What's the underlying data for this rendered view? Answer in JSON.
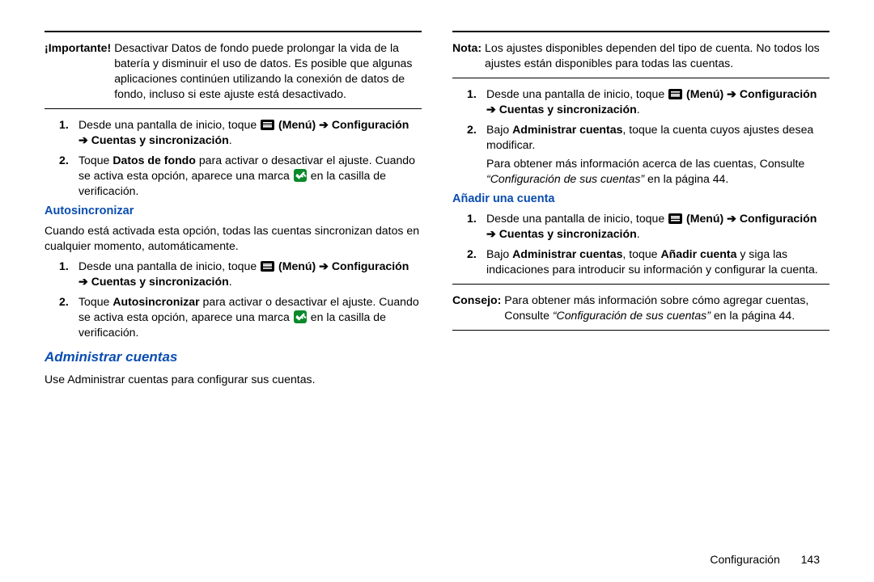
{
  "left": {
    "important": {
      "label": "¡Importante!",
      "text": "Desactivar Datos de fondo puede prolongar la vida de la batería y disminuir el uso de datos. Es posible que algunas aplicaciones continúen utilizando la conexión de datos de fondo, incluso si este ajuste está desactivado."
    },
    "steps1": {
      "s1a": "Desde una pantalla de inicio, toque ",
      "s1_menu": "(Menú)",
      "s1_arrow": " ➔ ",
      "s1_conf": "Configuración ➔ Cuentas y sincronización",
      "s1_dot": ".",
      "s2a": "Toque ",
      "s2b": "Datos de fondo",
      "s2c": " para activar o desactivar el ajuste. Cuando se activa esta opción, aparece una marca ",
      "s2d": " en la casilla de verificación."
    },
    "autosync_h": "Autosincronizar",
    "autosync_p": "Cuando está activada esta opción, todas las cuentas sincronizan datos en cualquier momento, automáticamente.",
    "steps2": {
      "s1a": "Desde una pantalla de inicio, toque ",
      "s1_menu": "(Menú)",
      "s1_arrow": " ➔ ",
      "s1_conf": "Configuración ➔ Cuentas y sincronización",
      "s1_dot": ".",
      "s2a": "Toque ",
      "s2b": "Autosincronizar",
      "s2c": " para activar o desactivar el ajuste. Cuando se activa esta opción, aparece una marca ",
      "s2d": " en la casilla de verificación."
    },
    "admin_h": "Administrar cuentas",
    "admin_p": "Use Administrar cuentas para configurar sus cuentas."
  },
  "right": {
    "nota": {
      "label": "Nota:",
      "text": "Los ajustes disponibles dependen del tipo de cuenta. No todos los ajustes están disponibles para todas las cuentas."
    },
    "steps3": {
      "s1a": "Desde una pantalla de inicio, toque ",
      "s1_menu": "(Menú)",
      "s1_arrow": " ➔ ",
      "s1_conf": "Configuración ➔ Cuentas y sincronización",
      "s1_dot": ".",
      "s2a": "Bajo ",
      "s2b": "Administrar cuentas",
      "s2c": ", toque la cuenta cuyos ajustes desea modificar.",
      "s2d": "Para obtener más información acerca de las cuentas, Consulte ",
      "s2e": "“Configuración de sus cuentas”",
      "s2f": " en la página 44."
    },
    "anadir_h": "Añadir una cuenta",
    "steps4": {
      "s1a": "Desde una pantalla de inicio, toque ",
      "s1_menu": "(Menú)",
      "s1_arrow": " ➔ ",
      "s1_conf": "Configuración ➔ Cuentas y sincronización",
      "s1_dot": ".",
      "s2a": "Bajo ",
      "s2b": "Administrar cuentas",
      "s2c": ", toque ",
      "s2d": "Añadir cuenta",
      "s2e": " y siga las indicaciones para introducir su información y configurar la cuenta."
    },
    "consejo": {
      "label": "Consejo:",
      "text1": "Para obtener más información sobre cómo agregar cuentas, Consulte ",
      "ref": "“Configuración de sus cuentas”",
      "text2": " en la página 44."
    }
  },
  "footer": {
    "section": "Configuración",
    "page": "143"
  }
}
